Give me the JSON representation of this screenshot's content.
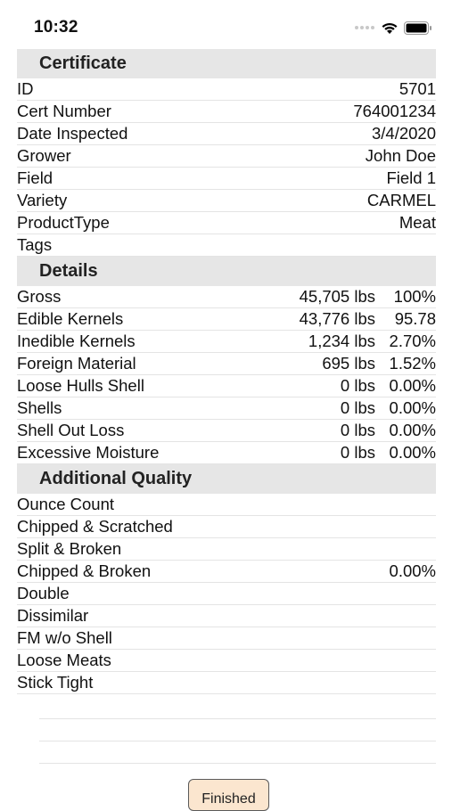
{
  "status_bar": {
    "time": "10:32",
    "icons": [
      "signal-dots-icon",
      "wifi-icon",
      "battery-icon"
    ]
  },
  "certificate": {
    "header": "Certificate",
    "rows": [
      {
        "label": "ID",
        "value": "5701"
      },
      {
        "label": "Cert Number",
        "value": "764001234"
      },
      {
        "label": "Date Inspected",
        "value": "3/4/2020"
      },
      {
        "label": "Grower",
        "value": "John Doe"
      },
      {
        "label": "Field",
        "value": "Field 1"
      },
      {
        "label": "Variety",
        "value": "CARMEL"
      },
      {
        "label": "ProductType",
        "value": "Meat"
      },
      {
        "label": "Tags",
        "value": ""
      }
    ]
  },
  "details": {
    "header": "Details",
    "rows": [
      {
        "label": "Gross",
        "amount": "45,705 lbs",
        "pct": "100%"
      },
      {
        "label": "Edible Kernels",
        "amount": "43,776 lbs",
        "pct": "95.78"
      },
      {
        "label": "Inedible Kernels",
        "amount": "1,234 lbs",
        "pct": "2.70%"
      },
      {
        "label": "Foreign Material",
        "amount": "695 lbs",
        "pct": "1.52%"
      },
      {
        "label": "Loose Hulls Shell",
        "amount": "0 lbs",
        "pct": "0.00%"
      },
      {
        "label": "Shells",
        "amount": "0 lbs",
        "pct": "0.00%"
      },
      {
        "label": "Shell Out Loss",
        "amount": "0 lbs",
        "pct": "0.00%"
      },
      {
        "label": "Excessive Moisture",
        "amount": "0 lbs",
        "pct": "0.00%"
      }
    ]
  },
  "additional_quality": {
    "header": "Additional Quality",
    "rows": [
      {
        "label": "Ounce Count",
        "value": ""
      },
      {
        "label": "Chipped & Scratched",
        "value": ""
      },
      {
        "label": "Split & Broken",
        "value": ""
      },
      {
        "label": "Chipped & Broken",
        "value": "0.00%"
      },
      {
        "label": "Double",
        "value": ""
      },
      {
        "label": "Dissimilar",
        "value": ""
      },
      {
        "label": "FM w/o Shell",
        "value": ""
      },
      {
        "label": "Loose Meats",
        "value": ""
      },
      {
        "label": "Stick Tight",
        "value": ""
      }
    ]
  },
  "footer": {
    "finished_label": "Finished"
  },
  "colors": {
    "section_header_bg": "#e6e6e6",
    "button_bg": "#fbe6cf",
    "separator": "#e4e4e4"
  }
}
